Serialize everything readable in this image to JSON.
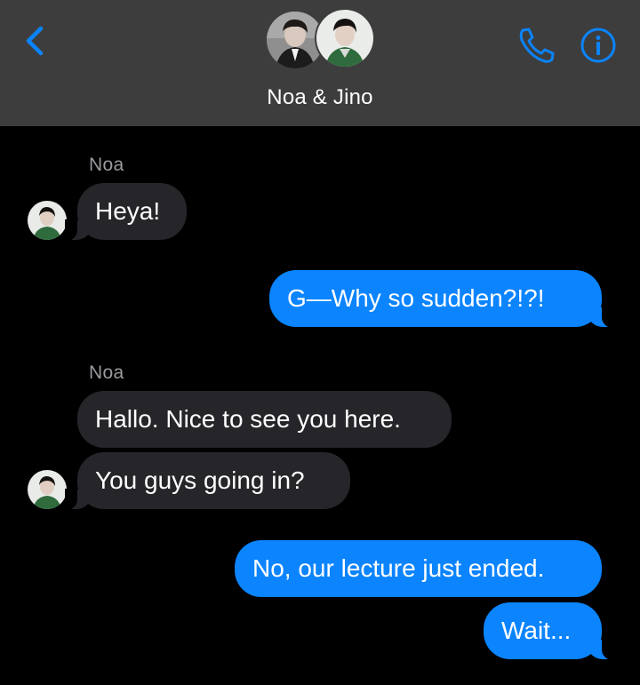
{
  "header": {
    "group_name": "Noa & Jino",
    "accent_color": "#0b84fe",
    "icons": [
      "chevron-left-icon",
      "phone-icon",
      "info-icon"
    ]
  },
  "messages": [
    {
      "side": "incoming",
      "sender": "Noa",
      "text": "Heya!"
    },
    {
      "side": "outgoing",
      "text": "G—Why so sudden?!?!"
    },
    {
      "side": "incoming",
      "sender": "Noa",
      "text": "Hallo. Nice to see you here."
    },
    {
      "side": "incoming",
      "text": "You guys going in?"
    },
    {
      "side": "outgoing",
      "text": "No, our lecture just ended."
    },
    {
      "side": "outgoing",
      "text": "Wait..."
    }
  ],
  "colors": {
    "header_bg": "#3d3d3d",
    "background": "#000000",
    "incoming_bubble": "#26252a",
    "outgoing_bubble": "#0b84fe",
    "sender_label": "#9a9a9f"
  }
}
